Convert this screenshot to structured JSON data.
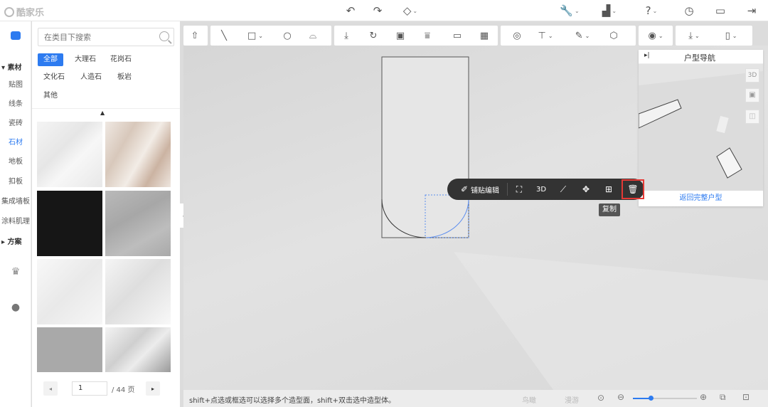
{
  "app": {
    "logo_text": "酷家乐"
  },
  "toolbar_top": {
    "icons": [
      "undo-icon",
      "redo-icon",
      "eraser-icon",
      "wrench-icon",
      "save-icon",
      "help-icon",
      "history-icon",
      "file-icon",
      "exit-icon"
    ]
  },
  "rail": {
    "group_material": "素材",
    "items": [
      "贴图",
      "线条",
      "瓷砖",
      "石材",
      "地板",
      "扣板",
      "集成墙板",
      "涂料肌理"
    ],
    "active": "石材",
    "group_plan": "方案"
  },
  "panel": {
    "search_placeholder": "在类目下搜索",
    "chips": [
      "全部",
      "大理石",
      "花岗石",
      "文化石",
      "人造石",
      "板岩",
      "其他"
    ],
    "active_chip": "全部",
    "page_current": "1",
    "page_total": "/ 44 页"
  },
  "nav": {
    "title": "户型导航",
    "btn_3d": "3D",
    "return_link": "返回完整户型"
  },
  "float_toolbar": {
    "edit_label": "铺贴编辑",
    "btn_3d": "3D",
    "tooltip": "复制"
  },
  "status": {
    "hint": "shift+点选或框选可以选择多个造型面，shift+双击选中造型体。",
    "mode_a": "鸟瞰",
    "mode_b": "漫游"
  },
  "colors": {
    "accent": "#2d7bf0",
    "highlight_box": "#e53935",
    "float_bg": "#333333"
  }
}
